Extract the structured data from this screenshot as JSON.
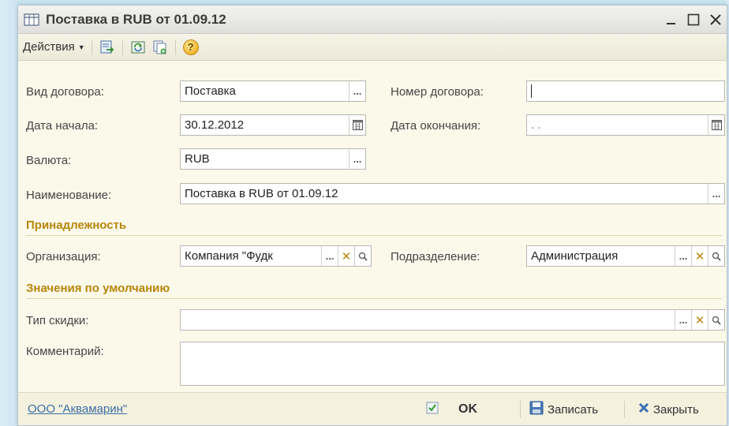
{
  "window": {
    "title": "Поставка в RUB от 01.09.12",
    "title_icon": "table-icon",
    "controls": [
      "minimize-icon",
      "maximize-icon",
      "close-icon"
    ]
  },
  "toolbar": {
    "actions_label": "Действия",
    "icons": [
      "post-document-icon",
      "refresh-icon",
      "copy-document-icon",
      "help-icon"
    ],
    "help_symbol": "?"
  },
  "form": {
    "contract_type": {
      "label": "Вид договора:",
      "value": "Поставка"
    },
    "contract_number": {
      "label": "Номер договора:",
      "value": ""
    },
    "start_date": {
      "label": "Дата начала:",
      "value": "30.12.2012"
    },
    "end_date": {
      "label": "Дата окончания:",
      "value": " .  ."
    },
    "currency": {
      "label": "Валюта:",
      "value": "RUB"
    },
    "name": {
      "label": "Наименование:",
      "value": "Поставка в RUB от 01.09.12"
    },
    "ownership_section": "Принадлежность",
    "organization": {
      "label": "Организация:",
      "value": "Компания \"Фудк"
    },
    "department": {
      "label": "Подразделение:",
      "value": "Администрация"
    },
    "defaults_section": "Значения по умолчанию",
    "discount_type": {
      "label": "Тип скидки:",
      "value": ""
    },
    "comment": {
      "label": "Комментарий:",
      "value": ""
    }
  },
  "bottom": {
    "org_link": "ООО \"Аквамарин\"",
    "ok_label": "OK",
    "save_label": "Записать",
    "close_label": "Закрыть"
  },
  "colors": {
    "window_bg": "#fbf9ea",
    "section_title": "#b8860b",
    "link": "#3b6ea5",
    "backdrop": "#c9e3ef"
  }
}
